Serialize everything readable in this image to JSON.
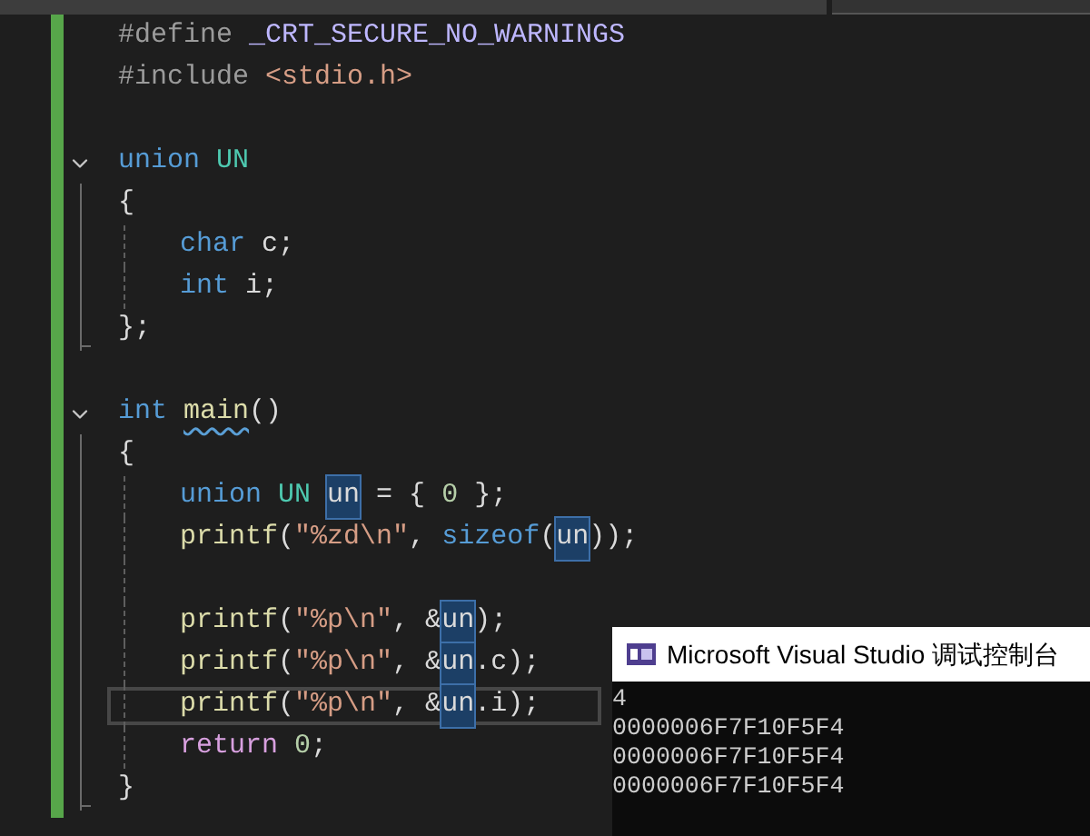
{
  "code": [
    {
      "kind": "line",
      "current": false,
      "tokens": [
        {
          "kind": "preproc",
          "text": "#define"
        },
        {
          "kind": "macro",
          "text": " _CRT_SECURE_NO_WARNINGS"
        }
      ]
    },
    {
      "kind": "line",
      "current": false,
      "tokens": [
        {
          "kind": "preproc",
          "text": "#include"
        },
        {
          "kind": "string",
          "text": " <stdio.h>"
        }
      ]
    },
    {
      "kind": "blank"
    },
    {
      "kind": "fold",
      "expanded": true,
      "header": [
        {
          "kind": "keyword",
          "text": "union"
        },
        {
          "kind": "type",
          "text": " UN"
        }
      ],
      "open": [
        {
          "kind": "plain",
          "text": "{"
        }
      ],
      "close": [
        {
          "kind": "plain",
          "text": "};"
        }
      ],
      "children": [
        {
          "kind": "line",
          "current": false,
          "tokens": [
            {
              "kind": "keyword",
              "text": "char"
            },
            {
              "kind": "plain",
              "text": " c;"
            }
          ]
        },
        {
          "kind": "line",
          "current": false,
          "tokens": [
            {
              "kind": "keyword",
              "text": "int"
            },
            {
              "kind": "plain",
              "text": " i;"
            }
          ]
        }
      ]
    },
    {
      "kind": "blank"
    },
    {
      "kind": "fold",
      "expanded": true,
      "header": [
        {
          "kind": "keyword",
          "text": "int "
        },
        {
          "kind": "function",
          "text": "main",
          "squiggle": true
        },
        {
          "kind": "plain",
          "text": "()"
        }
      ],
      "open": [
        {
          "kind": "plain",
          "text": "{"
        }
      ],
      "close": [
        {
          "kind": "plain",
          "text": "}"
        }
      ],
      "children": [
        {
          "kind": "line",
          "current": false,
          "tokens": [
            {
              "kind": "keyword",
              "text": "union"
            },
            {
              "kind": "type",
              "text": " UN "
            },
            {
              "kind": "var",
              "text": "un",
              "highlighted": true
            },
            {
              "kind": "plain",
              "text": " = { "
            },
            {
              "kind": "number",
              "text": "0"
            },
            {
              "kind": "plain",
              "text": " };"
            }
          ]
        },
        {
          "kind": "line",
          "current": false,
          "tokens": [
            {
              "kind": "function",
              "text": "printf"
            },
            {
              "kind": "plain",
              "text": "("
            },
            {
              "kind": "string",
              "text": "\"%zd\\n\""
            },
            {
              "kind": "plain",
              "text": ", "
            },
            {
              "kind": "keyword",
              "text": "sizeof"
            },
            {
              "kind": "plain",
              "text": "("
            },
            {
              "kind": "var",
              "text": "un",
              "highlighted": true
            },
            {
              "kind": "plain",
              "text": "));"
            }
          ]
        },
        {
          "kind": "blank"
        },
        {
          "kind": "line",
          "current": false,
          "tokens": [
            {
              "kind": "function",
              "text": "printf"
            },
            {
              "kind": "plain",
              "text": "("
            },
            {
              "kind": "string",
              "text": "\"%p\\n\""
            },
            {
              "kind": "plain",
              "text": ", &"
            },
            {
              "kind": "var",
              "text": "un",
              "highlighted": true
            },
            {
              "kind": "plain",
              "text": ");"
            }
          ]
        },
        {
          "kind": "line",
          "current": false,
          "tokens": [
            {
              "kind": "function",
              "text": "printf"
            },
            {
              "kind": "plain",
              "text": "("
            },
            {
              "kind": "string",
              "text": "\"%p\\n\""
            },
            {
              "kind": "plain",
              "text": ", &"
            },
            {
              "kind": "var",
              "text": "un",
              "highlighted": true
            },
            {
              "kind": "plain",
              "text": ".c);"
            }
          ]
        },
        {
          "kind": "line",
          "current": true,
          "tokens": [
            {
              "kind": "function",
              "text": "printf"
            },
            {
              "kind": "plain",
              "text": "("
            },
            {
              "kind": "string",
              "text": "\"%p\\n\""
            },
            {
              "kind": "plain",
              "text": ", &"
            },
            {
              "kind": "var",
              "text": "un",
              "highlighted": true
            },
            {
              "kind": "plain",
              "text": ".i);"
            }
          ]
        },
        {
          "kind": "line",
          "current": false,
          "tokens": [
            {
              "kind": "control",
              "text": "return"
            },
            {
              "kind": "number",
              "text": " 0"
            },
            {
              "kind": "plain",
              "text": ";"
            }
          ]
        }
      ]
    }
  ],
  "console": {
    "title": "Microsoft Visual Studio 调试控制台",
    "output": [
      "4",
      "0000006F7F10F5F4",
      "0000006F7F10F5F4",
      "0000006F7F10F5F4"
    ]
  }
}
